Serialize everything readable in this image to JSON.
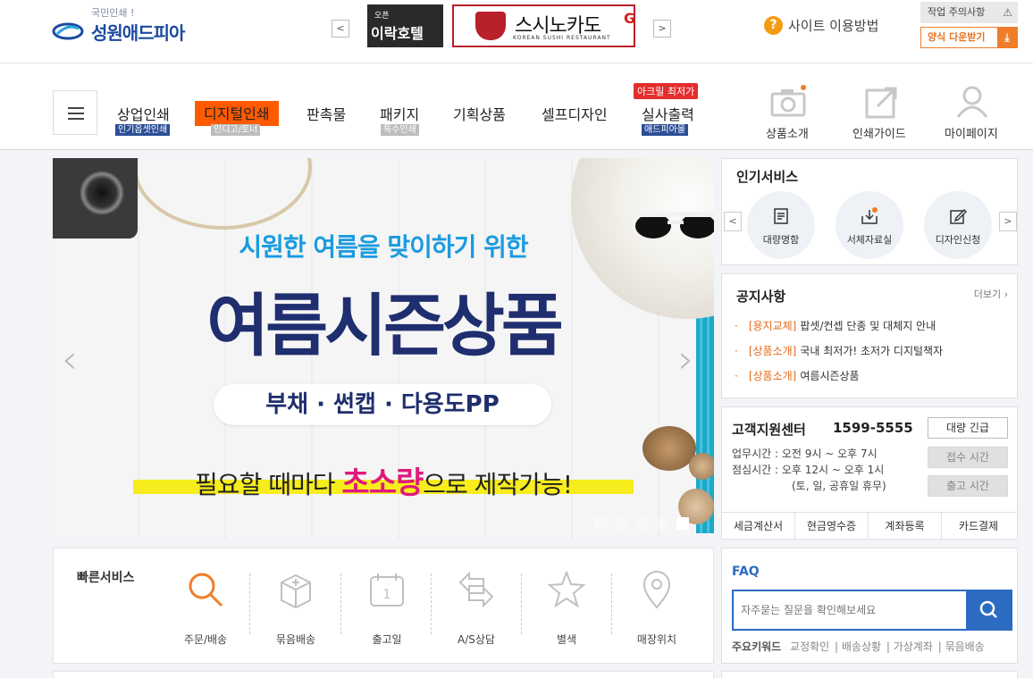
{
  "header": {
    "logo_tag": "국민인쇄 !",
    "logo_name": "성원애드피아",
    "ad_prev": "<",
    "ad_next": ">",
    "ad1_small": "오픈",
    "ad1_big": "이락호텔",
    "ad2_title": "스시노카도",
    "ad2_sub": "KOREAN SUSHI RESTAURANT",
    "ad2_edge": "G",
    "help_label": "사이트 이용방법",
    "caution_label": "작업 주의사항",
    "download_label": "양식 다운받기"
  },
  "nav": {
    "items": [
      {
        "label": "상업인쇄",
        "sub": "인기옵셋인쇄"
      },
      {
        "label": "디지털인쇄",
        "sub": "인디고/토너"
      },
      {
        "label": "판촉물",
        "sub": ""
      },
      {
        "label": "패키지",
        "sub": "특수인쇄"
      },
      {
        "label": "기획상품",
        "sub": ""
      },
      {
        "label": "셀프디자인",
        "sub": ""
      },
      {
        "label": "실사출력",
        "sub": "애드피아몰"
      }
    ],
    "hot_badge": "아크릴 최저가",
    "right": [
      {
        "label": "상품소개",
        "icon": "camera-icon"
      },
      {
        "label": "인쇄가이드",
        "icon": "share-icon"
      },
      {
        "label": "마이페이지",
        "icon": "user-icon"
      }
    ]
  },
  "banner": {
    "line1": "시원한 여름을 맞이하기 위한",
    "line2": "여름시즌상품",
    "pill": "부채 · 썬캡 · 다용도PP",
    "line4_pre": "필요할 때마다 ",
    "line4_em": "초소량",
    "line4_post": "으로 제작가능!",
    "prev": "‹",
    "next": "›",
    "slide_count": 5,
    "active_slide": 5
  },
  "quick": {
    "title": "빠른서비스",
    "items": [
      {
        "label": "주문/배송",
        "icon": "search-icon"
      },
      {
        "label": "묶음배송",
        "icon": "box-icon"
      },
      {
        "label": "출고일",
        "icon": "calendar-icon"
      },
      {
        "label": "A/S상담",
        "icon": "exchange-icon"
      },
      {
        "label": "별색",
        "icon": "star-icon"
      },
      {
        "label": "매장위치",
        "icon": "location-pin-icon"
      }
    ]
  },
  "popular": {
    "title": "인기서비스",
    "items": [
      {
        "label": "대량명함",
        "icon": "card-icon"
      },
      {
        "label": "서체자료실",
        "icon": "font-download-icon",
        "badge": "N"
      },
      {
        "label": "디자인신청",
        "icon": "edit-icon"
      }
    ]
  },
  "notice": {
    "title": "공지사항",
    "more": "더보기",
    "items": [
      {
        "cat": "[용지교체]",
        "text": "팝셋/컨셉 단종 및 대체지 안내"
      },
      {
        "cat": "[상품소개]",
        "text": "국내 최저가! 초저가 디지털책자"
      },
      {
        "cat": "[상품소개]",
        "text": "여름시즌상품"
      }
    ]
  },
  "cs": {
    "title": "고객지원센터",
    "phone": "1599-5555",
    "hours1": "업무시간  :  오전  9시 ~ 오후 7시",
    "hours2": "점심시간  :  오후 12시 ~ 오후 1시",
    "hours3": "(토, 일, 공휴일 휴무)",
    "btn_bulk": "대량 긴급",
    "btn_receive": "접수 시간",
    "btn_ship": "출고 시간",
    "tabs": [
      "세금계산서",
      "현금영수증",
      "계좌등록",
      "카드결제"
    ]
  },
  "faq": {
    "title": "FAQ",
    "placeholder": "자주묻는 질문을 확인해보세요",
    "kw_label": "주요키워드",
    "keywords": [
      "교정확인",
      "배송상황",
      "가상계좌",
      "묶음배송"
    ]
  },
  "colors": {
    "accent_orange": "#ff5a00",
    "brand_blue": "#1b4aa0",
    "banner_navy": "#1f2e6e",
    "banner_sky": "#1a9be0",
    "banner_pink": "#e0197d",
    "faq_blue": "#2c6bc2"
  }
}
